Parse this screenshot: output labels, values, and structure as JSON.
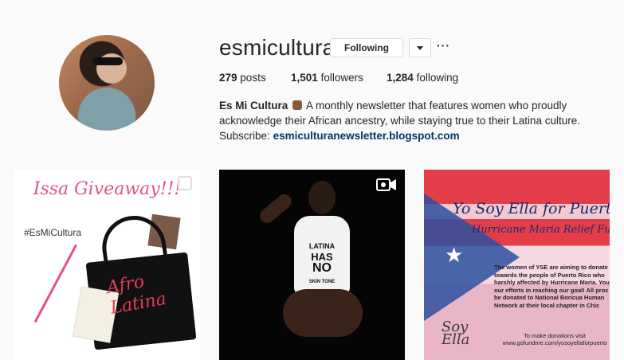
{
  "profile": {
    "username": "esmicultura",
    "following_label": "Following",
    "more_label": "···",
    "stats": {
      "posts_count": "279",
      "posts_label": "posts",
      "followers_count": "1,501",
      "followers_label": "followers",
      "following_count": "1,284",
      "following_label": "following"
    },
    "bio": {
      "name": "Es Mi Cultura",
      "text_line1": "A monthly newsletter that features women who proudly",
      "text_line2": "acknowledge their African ancestry, while staying true to their Latina culture.",
      "subscribe_label": "Subscribe:",
      "link": "esmiculturanewsletter.blogspot.com"
    }
  },
  "posts": [
    {
      "title": "Issa Giveaway!!!",
      "hashtag": "#EsMiCultura",
      "bag_text_line1": "Afro",
      "bag_text_line2": "Latina"
    },
    {
      "shirt_line1": "LATINA",
      "shirt_line2": "HAS",
      "shirt_line3": "NO",
      "shirt_line4": "SKIN TONE"
    },
    {
      "title": "Yo Soy Ella for Puerto",
      "subtitle": "Hurricane Maria Relief Fund",
      "body": "The women of YSE are aiming to donate towards the people of Puerto Rico who harshly affected by Hurricane Maria. You our efforts in reaching our goal! All proc be donated to National Boricua Human Network at their local chapter in Chic",
      "logo_line1": "Soy",
      "logo_line2": "Ella",
      "footer_line1": "To make donations visit",
      "footer_line2": "www.gofundme.com/yosoyellaforpuerto"
    }
  ]
}
